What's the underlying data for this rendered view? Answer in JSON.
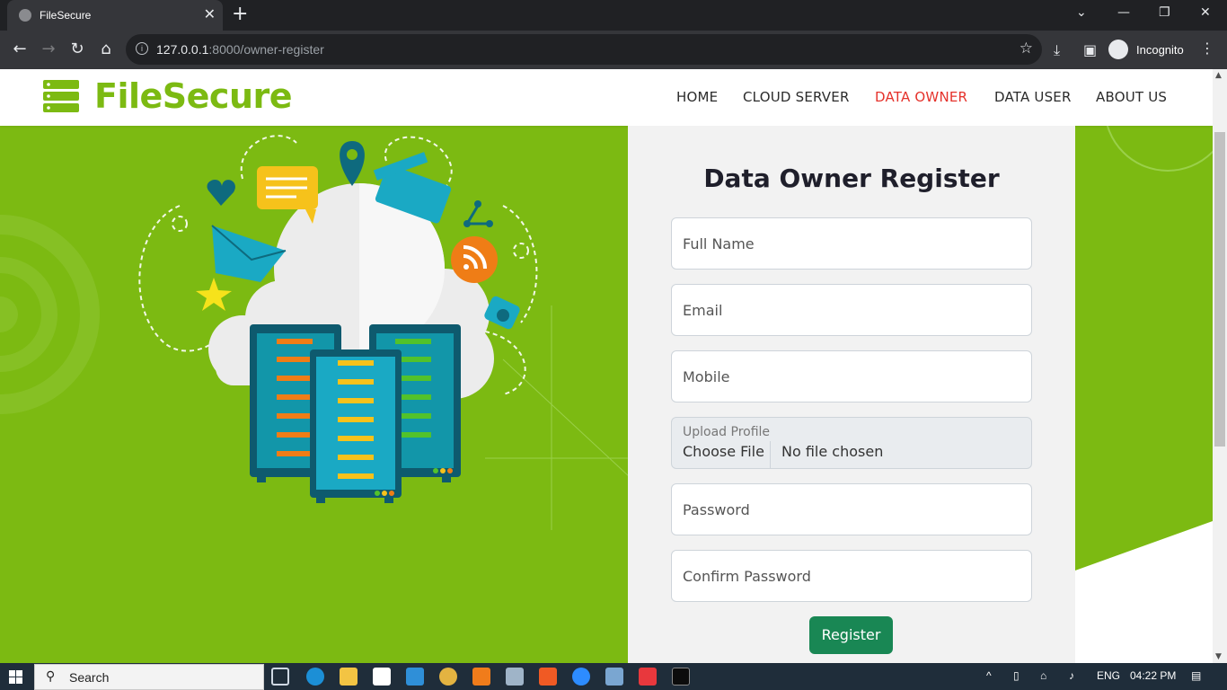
{
  "browser": {
    "tab_title": "FileSecure",
    "tab_close": "✕",
    "new_tab": "+",
    "url_host": "127.0.0.1",
    "url_rest": ":8000/owner-register",
    "profile_label": "Incognito",
    "window_controls": [
      "⌄",
      "—",
      "❐",
      "✕"
    ]
  },
  "site": {
    "logo_text": "FileSecure",
    "nav": [
      "HOME",
      "CLOUD SERVER",
      "DATA OWNER",
      "DATA USER",
      "ABOUT US"
    ],
    "active_nav": "DATA OWNER",
    "brand_color": "#7cba12",
    "active_color": "#e5322b"
  },
  "form": {
    "title": "Data Owner Register",
    "full_name_placeholder": "Full Name",
    "email_placeholder": "Email",
    "mobile_placeholder": "Mobile",
    "upload_label": "Upload Profile",
    "choose_file": "Choose File",
    "no_file": "No file chosen",
    "password_placeholder": "Password",
    "confirm_placeholder": "Confirm Password",
    "register_label": "Register",
    "button_color": "#198754"
  },
  "taskbar": {
    "search_label": "Search",
    "language": "ENG",
    "time": "04:22 PM"
  }
}
